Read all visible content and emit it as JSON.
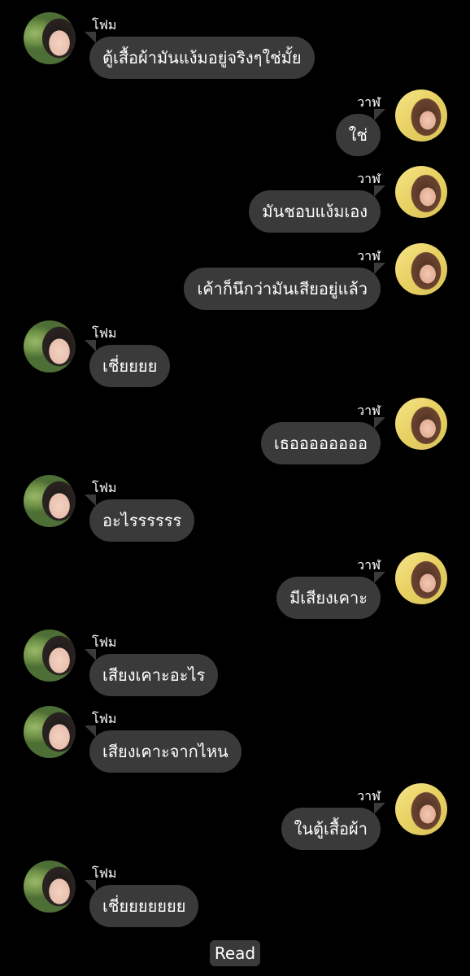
{
  "chat": {
    "messages": [
      {
        "sender": "โฟม",
        "text": "ตู้เสื้อผ้ามันแง้มอยู่จริงๆใช่มั้ย"
      },
      {
        "sender": "วาฬ",
        "text": "ใช่"
      },
      {
        "sender": "วาฬ",
        "text": "มันชอบแง้มเอง"
      },
      {
        "sender": "วาฬ",
        "text": "เค้าก็นึกว่ามันเสียอยู่แล้ว"
      },
      {
        "sender": "โฟม",
        "text": "เชี่ยยยย"
      },
      {
        "sender": "วาฬ",
        "text": "เธออออออออ"
      },
      {
        "sender": "โฟม",
        "text": "อะไรรรรรร"
      },
      {
        "sender": "วาฬ",
        "text": "มีเสียงเคาะ"
      },
      {
        "sender": "โฟม",
        "text": "เสียงเคาะอะไร"
      },
      {
        "sender": "โฟม",
        "text": "เสียงเคาะจากไหน"
      },
      {
        "sender": "วาฬ",
        "text": "ในตู้เสื้อผ้า"
      },
      {
        "sender": "โฟม",
        "text": "เชี่ยยยยยยย"
      }
    ],
    "read_label": "Read"
  },
  "colors": {
    "background": "#000000",
    "bubble": "#3a3a3a",
    "text": "#ffffff"
  }
}
